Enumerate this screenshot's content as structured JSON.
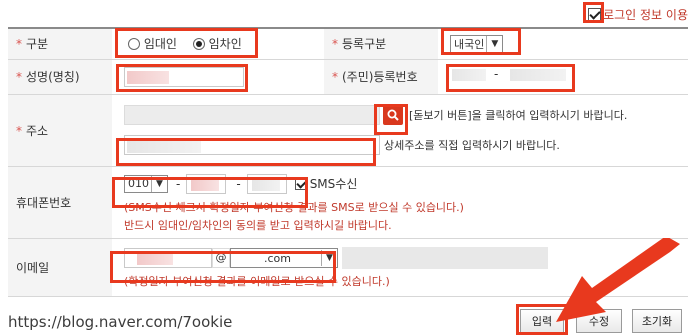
{
  "login_option": {
    "label": "로그인 정보 이용",
    "checked": true
  },
  "form": {
    "type_row": {
      "label": "구분",
      "required": true,
      "options": [
        {
          "label": "임대인",
          "selected": false
        },
        {
          "label": "임차인",
          "selected": true
        }
      ]
    },
    "reg_type_row": {
      "label": "등록구분",
      "required": true,
      "selected": "내국인"
    },
    "name_row": {
      "label": "성명(명칭)",
      "required": true
    },
    "reg_no_row": {
      "label": "(주민)등록번호",
      "required": true,
      "separator": "-"
    },
    "address_row": {
      "label": "주소",
      "required": true,
      "search_hint": "[돋보기 버튼]을 클릭하여 입력하시기 바랍니다.",
      "detail_hint": "상세주소를 직접 입력하시기 바랍니다."
    },
    "phone_row": {
      "label": "휴대폰번호",
      "prefix": "010",
      "dash": "-",
      "sms_label": "SMS수신",
      "sms_checked": true,
      "note_line1": "(SMS수신 체크시 확정일자 부여신청 결과를 SMS로 받으실 수 있습니다.)",
      "note_line2": "반드시 임대인/임차인의 동의를 받고 입력하시길 바랍니다."
    },
    "email_row": {
      "label": "이메일",
      "at": "@",
      "domain": ".com",
      "note": "(확정일자 부여신청 결과를 이메일로 받으실 수 있습니다.)"
    }
  },
  "buttons": {
    "submit": "입력",
    "edit": "수정",
    "reset": "초기화"
  },
  "watermark": "https://blog.naver.com/7ookie",
  "colors": {
    "highlight": "#e8391e",
    "required": "#d9534f",
    "note": "#c0392b"
  }
}
